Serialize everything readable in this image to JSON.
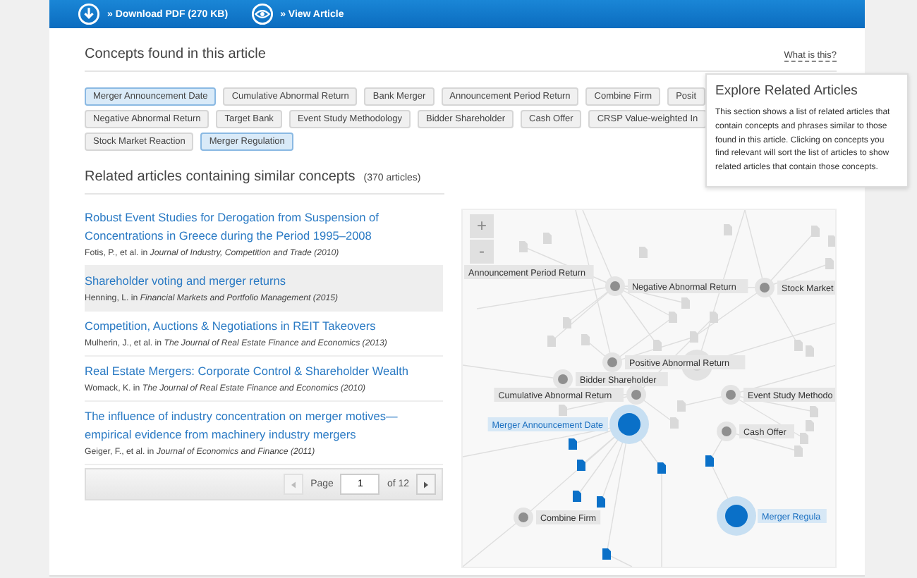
{
  "header": {
    "links": [
      {
        "label": "» Download PDF (270 KB)",
        "kind": "download"
      },
      {
        "label": "» View Article",
        "kind": "view"
      }
    ]
  },
  "concepts": {
    "title": "Concepts found in this article",
    "help_link": "What is this?",
    "tag_rows": [
      [
        {
          "label": "Merger Announcement Date",
          "selected": true
        },
        {
          "label": "Cumulative Abnormal Return",
          "selected": false
        },
        {
          "label": "Bank Merger",
          "selected": false
        },
        {
          "label": "Announcement Period Return",
          "selected": false
        },
        {
          "label": "Combine Firm",
          "selected": false
        },
        {
          "label": "Posit",
          "selected": false
        }
      ],
      [
        {
          "label": "Negative Abnormal Return",
          "selected": false
        },
        {
          "label": "Target Bank",
          "selected": false
        },
        {
          "label": "Event Study Methodology",
          "selected": false
        },
        {
          "label": "Bidder Shareholder",
          "selected": false
        },
        {
          "label": "Cash Offer",
          "selected": false
        },
        {
          "label": "CRSP Value-weighted In",
          "selected": false
        }
      ],
      [
        {
          "label": "Stock Market Reaction",
          "selected": false
        },
        {
          "label": "Merger Regulation",
          "selected": true
        }
      ]
    ]
  },
  "tooltip": {
    "title": "Explore Related Articles",
    "text": "This section shows a list of related articles that contain concepts and phrases similar to those found in this article. Clicking on concepts you find relevant will sort the list of articles to show related articles that contain those concepts."
  },
  "related": {
    "title": "Related articles containing similar concepts",
    "count": "(370 articles)",
    "articles": [
      {
        "title": "Robust Event Studies for Derogation from Suspension of Concentrations in Greece during the Period 1995–2008",
        "meta": "Fotis, P., et al. in *Journal of Industry, Competition and Trade (2010)*",
        "selected": false
      },
      {
        "title": "Shareholder voting and merger returns",
        "meta": "Henning, L. in *Financial Markets and Portfolio Management (2015)*",
        "selected": true
      },
      {
        "title": "Competition, Auctions & Negotiations in REIT Takeovers",
        "meta": "Mulherin, J., et al. in *The Journal of Real Estate Finance and Economics (2013)*",
        "selected": false
      },
      {
        "title": "Real Estate Mergers: Corporate Control & Shareholder Wealth",
        "meta": "Womack, K. in *The Journal of Real Estate Finance and Economics (2010)*",
        "selected": false
      },
      {
        "title": "The influence of industry concentration on merger motives—empirical evidence from machinery industry mergers",
        "meta": "Geiger, F., et al. in *Journal of Economics and Finance (2011)*",
        "selected": false
      }
    ],
    "pager": {
      "label": "Page",
      "value": "1",
      "total": "of 12"
    }
  },
  "graph": {
    "zoom_in": "+",
    "zoom_out": "-",
    "nodes": [
      {
        "label": "Announcement Period Return",
        "selected": false
      },
      {
        "label": "Negative Abnormal Return",
        "selected": false
      },
      {
        "label": "Stock Market",
        "selected": false
      },
      {
        "label": "Positive Abnormal Return",
        "selected": false
      },
      {
        "label": "Bidder Shareholder",
        "selected": false
      },
      {
        "label": "Cumulative Abnormal Return",
        "selected": false
      },
      {
        "label": "Event Study Methodo",
        "selected": false
      },
      {
        "label": "Merger Announcement Date",
        "selected": true
      },
      {
        "label": "Cash Offer",
        "selected": false
      },
      {
        "label": "Combine Firm",
        "selected": false
      },
      {
        "label": "Merger Regula",
        "selected": true
      }
    ]
  }
}
